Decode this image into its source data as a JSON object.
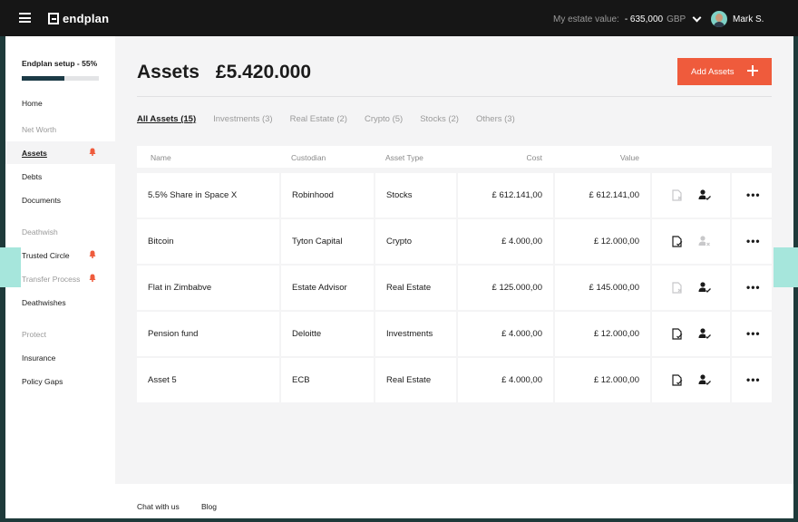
{
  "app": {
    "brand": "endplan"
  },
  "header": {
    "estate_label": "My estate value:",
    "estate_value": "- 635,000",
    "estate_currency": "GBP",
    "username": "Mark S."
  },
  "sidebar": {
    "setup_label": "Endplan setup - 55%",
    "setup_progress_percent": 55,
    "items": {
      "home": "Home",
      "net_worth": "Net Worth",
      "assets": "Assets",
      "debts": "Debts",
      "documents": "Documents",
      "deathwish": "Deathwish",
      "trusted_circle": "Trusted Circle",
      "transfer_process": "Transfer Process",
      "deathwishes": "Deathwishes",
      "protect": "Protect",
      "insurance": "Insurance",
      "policy_gaps": "Policy Gaps"
    }
  },
  "main": {
    "title": "Assets",
    "total": "£5.420.000",
    "add_button": "Add Assets",
    "tabs": [
      "All Assets (15)",
      "Investments (3)",
      "Real Estate (2)",
      "Crypto (5)",
      "Stocks (2)",
      "Others (3)"
    ],
    "columns": [
      "Name",
      "Custodian",
      "Asset Type",
      "Cost",
      "Value"
    ],
    "rows": [
      {
        "name": "5.5% Share in Space X",
        "custodian": "Robinhood",
        "type": "Stocks",
        "cost": "£ 612.141,00",
        "value": "£ 612.141,00",
        "doc_status": "missing",
        "person_status": "assigned"
      },
      {
        "name": "Bitcoin",
        "custodian": "Tyton Capital",
        "type": "Crypto",
        "cost": "£ 4.000,00",
        "value": "£ 12.000,00",
        "doc_status": "ok",
        "person_status": "missing"
      },
      {
        "name": "Flat in Zimbabve",
        "custodian": "Estate Advisor",
        "type": "Real Estate",
        "cost": "£ 125.000,00",
        "value": "£ 145.000,00",
        "doc_status": "missing",
        "person_status": "assigned"
      },
      {
        "name": "Pension fund",
        "custodian": "Deloitte",
        "type": "Investments",
        "cost": "£ 4.000,00",
        "value": "£ 12.000,00",
        "doc_status": "ok",
        "person_status": "assigned"
      },
      {
        "name": "Asset 5",
        "custodian": "ECB",
        "type": "Real Estate",
        "cost": "£ 4.000,00",
        "value": "£ 12.000,00",
        "doc_status": "ok",
        "person_status": "assigned"
      }
    ]
  },
  "footer": {
    "chat": "Chat with us",
    "blog": "Blog"
  },
  "colors": {
    "accent": "#ef5b3c",
    "topbar": "#161616",
    "teal": "#a6e6dc",
    "progress": "#1c3a46"
  }
}
